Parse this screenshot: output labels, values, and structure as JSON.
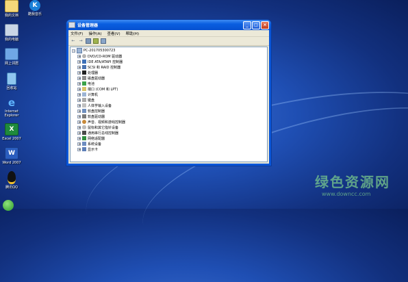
{
  "desktop": {
    "icons": [
      {
        "label": "我的文档"
      },
      {
        "label": "酷我音乐"
      },
      {
        "label": "我的电脑"
      },
      {
        "label": "网上邻居"
      },
      {
        "label": "回收站"
      },
      {
        "label": "Internet Explorer"
      },
      {
        "label": "Excel 2007"
      },
      {
        "label": "Word 2007"
      },
      {
        "label": "腾讯QQ"
      }
    ]
  },
  "window": {
    "title": "设备管理器",
    "min": "_",
    "max": "□",
    "close": "×",
    "menu": [
      "文件(F)",
      "操作(A)",
      "查看(V)",
      "帮助(H)"
    ],
    "toolbar": [
      "←",
      "→"
    ],
    "tree": {
      "root": "PC-201705300723",
      "items": [
        "DVD/CD-ROM 驱动器",
        "IDE ATA/ATAPI 控制器",
        "SCSI 和 RAID 控制器",
        "处理器",
        "磁盘驱动器",
        "电池",
        "端口 (COM 和 LPT)",
        "计算机",
        "键盘",
        "人体学输入设备",
        "软盘控制器",
        "软盘驱动器",
        "声音、视频和游戏控制器",
        "鼠标和其它指针设备",
        "通用串行总线控制器",
        "网络适配器",
        "系统设备",
        "显示卡"
      ]
    }
  },
  "watermark": {
    "main": "绿色资源网",
    "url": "www.downcc.com"
  }
}
